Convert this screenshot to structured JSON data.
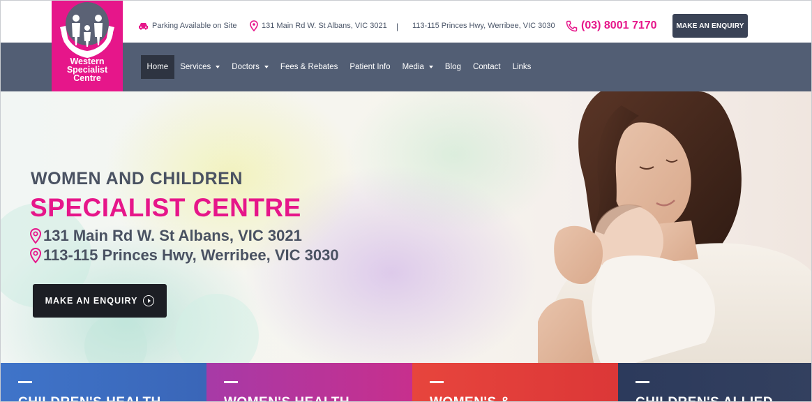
{
  "brand": {
    "name": "Western Specialist Centre",
    "name_lines": [
      "Western",
      "Specialist",
      "Centre"
    ],
    "color": "#e6168a"
  },
  "topbar": {
    "parking": "Parking Available on Site",
    "address_1": "131 Main Rd W. St Albans, VIC 3021",
    "separator": "|",
    "address_2": "113-115 Princes Hwy, Werribee, VIC 3030",
    "phone": "(03) 8001 7170",
    "enquiry_button": "MAKE AN ENQUIRY",
    "icons": [
      "car-icon",
      "map-pin-icon",
      "phone-icon"
    ]
  },
  "nav": {
    "items": [
      {
        "label": "Home",
        "active": true
      },
      {
        "label": "Services",
        "dropdown": true
      },
      {
        "label": "Doctors",
        "dropdown": true
      },
      {
        "label": "Fees & Rebates"
      },
      {
        "label": "Patient Info"
      },
      {
        "label": "Media",
        "dropdown": true
      },
      {
        "label": "Blog"
      },
      {
        "label": "Contact"
      },
      {
        "label": "Links"
      }
    ],
    "background": "#525e74"
  },
  "hero": {
    "title_line1": "WOMEN AND CHILDREN",
    "title_line2": "SPECIALIST CENTRE",
    "address_1": "131 Main Rd W. St Albans, VIC 3021",
    "address_2": "113-115 Princes Hwy, Werribee, VIC 3030",
    "button": "MAKE AN ENQUIRY"
  },
  "tiles": [
    {
      "label": "CHILDREN'S HEALTH",
      "color": "#3d6fc4"
    },
    {
      "label": "WOMEN'S HEALTH",
      "color": "#b6339a"
    },
    {
      "label": "WOMEN'S & ...",
      "color": "#e23d3a"
    },
    {
      "label": "CHILDREN'S ALLIED",
      "color": "#2f3b5a"
    }
  ]
}
